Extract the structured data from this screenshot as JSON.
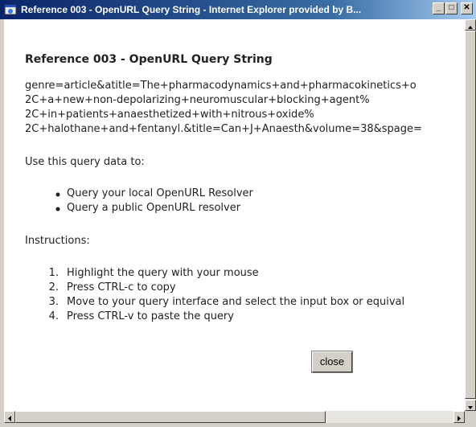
{
  "window": {
    "title": "Reference 003 - OpenURL Query String - Internet Explorer provided by B...",
    "buttons": {
      "minimize": "_",
      "maximize": "□",
      "close": "✕"
    }
  },
  "page": {
    "heading": "Reference 003 - OpenURL Query String",
    "query_lines": [
      "genre=article&atitle=The+pharmacodynamics+and+pharmacokinetics+o",
      "2C+a+new+non-depolarizing+neuromuscular+blocking+agent%",
      "2C+in+patients+anaesthetized+with+nitrous+oxide%",
      "2C+halothane+and+fentanyl.&title=Can+J+Anaesth&volume=38&spage="
    ],
    "use_intro": "Use this query data to:",
    "use_items": [
      "Query your local OpenURL Resolver",
      "Query a public OpenURL resolver"
    ],
    "instructions_label": "Instructions:",
    "steps": [
      {
        "num": "1.",
        "text": "Highlight the query with your mouse"
      },
      {
        "num": "2.",
        "text": "Press CTRL-c to copy"
      },
      {
        "num": "3.",
        "text": "Move to your query interface and select the input box or equival"
      },
      {
        "num": "4.",
        "text": "Press CTRL-v to paste the query"
      }
    ],
    "close_label": "close"
  }
}
